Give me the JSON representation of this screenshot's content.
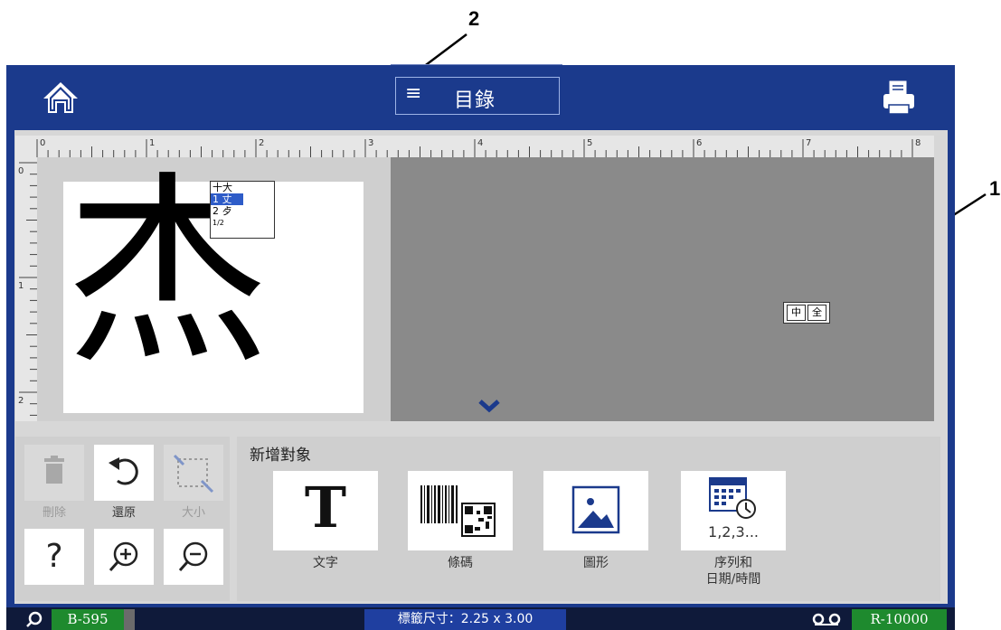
{
  "header": {
    "menu_label": "目錄",
    "home_icon": "home-icon",
    "print_icon": "printer-icon"
  },
  "ruler": {
    "top_numbers": [
      "0",
      "1",
      "2",
      "3",
      "4",
      "5",
      "6",
      "7",
      "8"
    ],
    "left_numbers": [
      "0",
      "1",
      "2"
    ]
  },
  "canvas": {
    "glyph": "杰"
  },
  "candidate_popup": {
    "items": [
      "十大",
      "1 丈",
      "2 歺",
      "1/2"
    ]
  },
  "ime_toggle": {
    "left": "中",
    "right": "全"
  },
  "tools": {
    "delete_label": "刪除",
    "undo_label": "還原",
    "resize_label": "大小",
    "help_label": "?"
  },
  "objects": {
    "heading": "新增對象",
    "text_label": "文字",
    "text_glyph": "T",
    "barcode_label": "條碼",
    "graphic_label": "圖形",
    "serial_label_line1": "序列和",
    "serial_label_line2": "日期/時間",
    "serial_icon_text": "1,2,3..."
  },
  "status": {
    "printer": "B-595",
    "label_size": "標籤尺寸：2.25 x 3.00",
    "ribbon": "R-10000"
  },
  "callouts": {
    "one": "1",
    "two": "2"
  },
  "colors": {
    "header_blue": "#1b3a8c",
    "status_navy": "#0f1a3a",
    "chip_green": "#1e8a2e",
    "size_blue": "#1f3fa0"
  }
}
